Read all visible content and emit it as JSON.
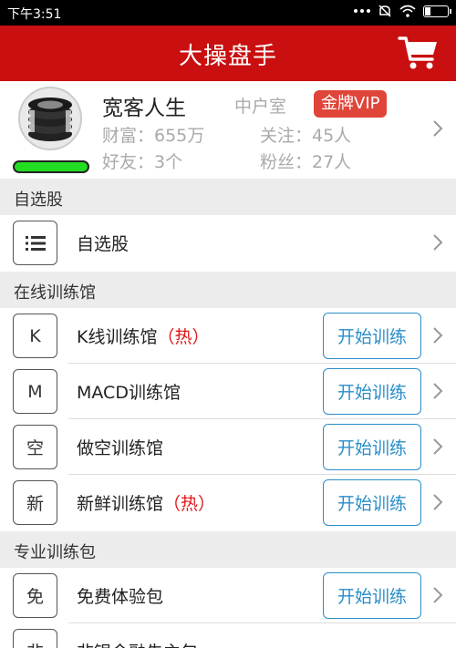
{
  "status_bar": {
    "time": "下午3:51"
  },
  "header": {
    "title": "大操盘手"
  },
  "profile": {
    "name": "宽客人生",
    "room": "中户室",
    "vip_badge": "金牌VIP",
    "wealth": "财富：655万",
    "following": "关注：45人",
    "friends": "好友：3个",
    "fans": "粉丝：27人"
  },
  "sections": {
    "favorites": {
      "title": "自选股",
      "items": [
        {
          "label": "自选股"
        }
      ]
    },
    "training": {
      "title": "在线训练馆",
      "items": [
        {
          "icon": "K",
          "label": "K线训练馆",
          "hot": "（热）",
          "button": "开始训练"
        },
        {
          "icon": "M",
          "label": "MACD训练馆",
          "hot": "",
          "button": "开始训练"
        },
        {
          "icon": "空",
          "label": "做空训练馆",
          "hot": "",
          "button": "开始训练"
        },
        {
          "icon": "新",
          "label": "新鲜训练馆",
          "hot": "（热）",
          "button": "开始训练"
        }
      ]
    },
    "packages": {
      "title": "专业训练包",
      "items": [
        {
          "icon": "免",
          "label": "免费体验包",
          "button": "开始训练"
        },
        {
          "icon": "非",
          "label": "非银金融先主包"
        }
      ]
    }
  },
  "colors": {
    "header_bg": "#c90f0f",
    "vip_bg": "#e0453a",
    "hot_text": "#e01919",
    "button_border": "#2a8ec9"
  }
}
